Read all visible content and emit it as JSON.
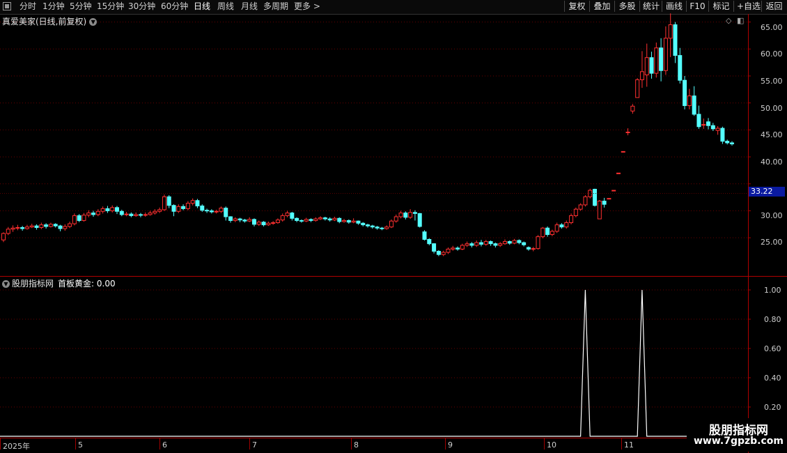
{
  "toolbar": {
    "periods": [
      "分时",
      "1分钟",
      "5分钟",
      "15分钟",
      "30分钟",
      "60分钟",
      "日线",
      "周线",
      "月线",
      "多周期",
      "更多 >"
    ],
    "active_period": "日线",
    "right_buttons": [
      "复权",
      "叠加",
      "多股",
      "统计",
      "画线",
      "F10",
      "标记",
      "+自选",
      "返回"
    ]
  },
  "main_chart": {
    "title": "真爱美家(日线,前复权)",
    "current_price": "33.22",
    "y_ticks": [
      "65.00",
      "60.00",
      "55.00",
      "50.00",
      "45.00",
      "40.00",
      "30.00",
      "25.00"
    ],
    "up_color": "#ff3030",
    "down_color": "#54ffff"
  },
  "indicator": {
    "source": "股朋指标网",
    "name_value": "首板黄金: 0.00",
    "y_ticks": [
      "1.00",
      "0.80",
      "0.60",
      "0.40",
      "0.20"
    ]
  },
  "x_axis": {
    "labels": [
      "2025年",
      "5",
      "6",
      "7",
      "8",
      "9",
      "10",
      "11"
    ]
  },
  "watermark": {
    "title": "股朋指标网",
    "url": "www.7gpzb.com"
  },
  "chart_data": {
    "type": "candlestick",
    "ylim": [
      20.5,
      66.5
    ],
    "candles": [
      [
        24.6,
        25.8,
        24.2,
        26.0
      ],
      [
        25.8,
        26.6,
        25.5,
        27.0
      ],
      [
        26.6,
        26.8,
        26.1,
        27.3
      ],
      [
        26.8,
        26.9,
        26.4,
        27.4
      ],
      [
        26.9,
        26.7,
        26.3,
        27.2
      ],
      [
        26.7,
        27.0,
        26.5,
        27.4
      ],
      [
        27.0,
        27.2,
        26.8,
        27.6
      ],
      [
        27.2,
        26.9,
        26.5,
        27.5
      ],
      [
        26.9,
        27.4,
        26.6,
        27.8
      ],
      [
        27.4,
        27.1,
        26.7,
        27.7
      ],
      [
        27.1,
        27.5,
        26.9,
        27.8
      ],
      [
        27.5,
        27.2,
        26.9,
        27.7
      ],
      [
        27.2,
        26.7,
        26.2,
        27.4
      ],
      [
        26.7,
        27.1,
        26.3,
        27.5
      ],
      [
        27.1,
        27.6,
        26.8,
        28.0
      ],
      [
        27.6,
        29.1,
        27.3,
        29.5
      ],
      [
        29.1,
        28.2,
        27.9,
        29.4
      ],
      [
        28.2,
        29.2,
        28.0,
        29.6
      ],
      [
        29.2,
        29.6,
        28.8,
        30.1
      ],
      [
        29.6,
        29.3,
        28.9,
        30.0
      ],
      [
        29.3,
        29.9,
        29.0,
        30.3
      ],
      [
        29.9,
        30.4,
        29.5,
        30.8
      ],
      [
        30.4,
        30.0,
        29.6,
        30.9
      ],
      [
        30.0,
        30.6,
        29.7,
        31.0
      ],
      [
        30.6,
        29.9,
        29.4,
        30.9
      ],
      [
        29.9,
        29.3,
        29.0,
        30.2
      ],
      [
        29.3,
        29.4,
        29.0,
        29.8
      ],
      [
        29.4,
        29.1,
        28.8,
        29.7
      ],
      [
        29.1,
        29.3,
        28.9,
        29.7
      ],
      [
        29.3,
        29.2,
        28.8,
        29.6
      ],
      [
        29.2,
        29.3,
        28.9,
        29.7
      ],
      [
        29.3,
        29.6,
        29.1,
        30.0
      ],
      [
        29.6,
        29.9,
        29.3,
        30.3
      ],
      [
        29.9,
        30.2,
        29.6,
        30.6
      ],
      [
        30.2,
        32.6,
        30.0,
        33.0
      ],
      [
        32.6,
        31.0,
        30.5,
        32.9
      ],
      [
        31.0,
        29.9,
        29.0,
        31.2
      ],
      [
        29.9,
        30.8,
        29.6,
        31.2
      ],
      [
        30.8,
        30.4,
        30.1,
        31.2
      ],
      [
        30.4,
        31.4,
        30.1,
        31.8
      ],
      [
        31.4,
        31.9,
        31.0,
        32.3
      ],
      [
        31.9,
        30.9,
        30.5,
        32.2
      ],
      [
        30.9,
        30.1,
        29.8,
        31.2
      ],
      [
        30.1,
        30.0,
        29.6,
        30.4
      ],
      [
        30.0,
        29.8,
        29.5,
        30.3
      ],
      [
        29.8,
        29.9,
        29.5,
        30.2
      ],
      [
        29.9,
        30.5,
        29.6,
        30.8
      ],
      [
        30.5,
        28.9,
        28.2,
        30.8
      ],
      [
        28.9,
        28.2,
        27.8,
        29.0
      ],
      [
        28.2,
        28.5,
        27.9,
        28.8
      ],
      [
        28.5,
        28.3,
        27.9,
        28.7
      ],
      [
        28.3,
        28.1,
        27.8,
        28.5
      ],
      [
        28.1,
        28.4,
        27.9,
        28.8
      ],
      [
        28.4,
        27.5,
        27.1,
        28.6
      ],
      [
        27.5,
        27.9,
        27.2,
        28.2
      ],
      [
        27.9,
        27.4,
        27.1,
        28.1
      ],
      [
        27.4,
        27.7,
        27.2,
        28.0
      ],
      [
        27.7,
        27.8,
        27.4,
        28.1
      ],
      [
        27.8,
        28.3,
        27.6,
        28.6
      ],
      [
        28.3,
        29.1,
        28.0,
        29.5
      ],
      [
        29.1,
        29.6,
        28.8,
        30.0
      ],
      [
        29.6,
        28.6,
        28.2,
        29.8
      ],
      [
        28.6,
        28.2,
        27.9,
        28.8
      ],
      [
        28.2,
        28.1,
        27.8,
        28.4
      ],
      [
        28.1,
        28.4,
        27.9,
        28.7
      ],
      [
        28.4,
        28.2,
        27.9,
        28.6
      ],
      [
        28.2,
        28.5,
        28.0,
        28.8
      ],
      [
        28.5,
        28.7,
        28.3,
        29.0
      ],
      [
        28.7,
        28.5,
        28.2,
        28.9
      ],
      [
        28.5,
        28.3,
        28.0,
        28.8
      ],
      [
        28.3,
        28.6,
        28.1,
        28.9
      ],
      [
        28.6,
        28.0,
        27.7,
        28.8
      ],
      [
        28.0,
        28.2,
        27.8,
        28.5
      ],
      [
        28.2,
        27.9,
        27.6,
        28.4
      ],
      [
        27.9,
        28.1,
        27.7,
        28.6
      ],
      [
        28.1,
        27.7,
        27.4,
        28.2
      ],
      [
        27.7,
        27.4,
        27.1,
        27.9
      ],
      [
        27.4,
        27.2,
        26.9,
        27.6
      ],
      [
        27.2,
        27.0,
        26.7,
        27.4
      ],
      [
        27.0,
        26.8,
        26.5,
        27.2
      ],
      [
        26.8,
        26.7,
        26.4,
        27.0
      ],
      [
        26.7,
        27.0,
        26.5,
        27.3
      ],
      [
        27.0,
        28.1,
        26.8,
        28.4
      ],
      [
        28.1,
        28.9,
        27.8,
        29.3
      ],
      [
        28.9,
        29.6,
        28.6,
        30.0
      ],
      [
        29.6,
        28.8,
        28.4,
        29.9
      ],
      [
        28.8,
        29.7,
        28.5,
        30.3
      ],
      [
        29.7,
        29.5,
        28.2,
        30.1
      ],
      [
        29.5,
        27.1,
        26.9,
        29.6
      ],
      [
        26.1,
        24.7,
        24.5,
        26.4
      ],
      [
        24.7,
        23.9,
        23.6,
        24.9
      ],
      [
        23.9,
        22.5,
        22.1,
        24.0
      ],
      [
        22.5,
        21.9,
        21.6,
        22.7
      ],
      [
        21.9,
        22.3,
        21.6,
        22.6
      ],
      [
        22.3,
        22.9,
        22.0,
        23.2
      ],
      [
        22.9,
        23.1,
        22.6,
        23.5
      ],
      [
        23.1,
        22.9,
        22.6,
        23.4
      ],
      [
        22.9,
        23.6,
        22.7,
        23.9
      ],
      [
        23.6,
        23.9,
        23.3,
        24.3
      ],
      [
        23.9,
        23.6,
        23.2,
        24.2
      ],
      [
        23.6,
        24.1,
        23.3,
        24.5
      ],
      [
        24.1,
        23.8,
        23.4,
        24.6
      ],
      [
        23.8,
        24.3,
        23.5,
        24.6
      ],
      [
        24.3,
        23.9,
        23.5,
        24.5
      ],
      [
        23.9,
        23.6,
        23.2,
        24.1
      ],
      [
        23.6,
        23.9,
        23.3,
        24.2
      ],
      [
        23.9,
        24.3,
        23.7,
        24.7
      ],
      [
        24.3,
        24.0,
        23.7,
        24.5
      ],
      [
        24.0,
        24.5,
        23.8,
        24.8
      ],
      [
        24.5,
        24.1,
        23.8,
        24.7
      ],
      [
        24.1,
        23.7,
        23.4,
        24.3
      ],
      [
        23.2,
        22.9,
        22.6,
        23.4
      ],
      [
        22.9,
        23.0,
        22.5,
        23.3
      ],
      [
        23.0,
        25.2,
        22.8,
        25.5
      ],
      [
        25.2,
        26.8,
        24.9,
        27.0
      ],
      [
        26.8,
        25.6,
        25.2,
        27.1
      ],
      [
        25.6,
        26.2,
        25.3,
        26.5
      ],
      [
        26.2,
        27.4,
        25.9,
        27.8
      ],
      [
        27.4,
        27.0,
        26.7,
        27.7
      ],
      [
        27.0,
        27.8,
        26.7,
        28.2
      ],
      [
        27.8,
        29.1,
        27.5,
        29.5
      ],
      [
        29.1,
        30.3,
        28.8,
        30.6
      ],
      [
        30.3,
        31.1,
        30.0,
        31.4
      ],
      [
        31.1,
        32.6,
        30.8,
        32.9
      ],
      [
        32.6,
        33.8,
        32.3,
        34.1
      ],
      [
        34.0,
        31.0,
        30.8,
        34.1
      ],
      [
        28.5,
        31.8,
        28.5,
        32.0
      ],
      [
        31.8,
        31.2,
        30.6,
        32.4
      ],
      [
        32.3,
        32.3,
        32.3,
        32.3
      ],
      [
        33.8,
        33.8,
        33.8,
        33.8
      ],
      [
        37.0,
        37.0,
        37.0,
        37.0
      ],
      [
        41.0,
        41.0,
        41.0,
        41.0
      ],
      [
        44.6,
        44.6,
        44.0,
        45.3
      ],
      [
        48.5,
        49.4,
        48.0,
        49.8
      ],
      [
        51.0,
        54.3,
        51.0,
        54.6
      ],
      [
        54.3,
        55.8,
        52.8,
        59.6
      ],
      [
        55.2,
        58.4,
        53.0,
        61.0
      ],
      [
        58.4,
        55.5,
        54.5,
        59.5
      ],
      [
        55.5,
        60.2,
        54.7,
        61.2
      ],
      [
        60.2,
        56.0,
        54.0,
        62.0
      ],
      [
        56.0,
        62.0,
        55.2,
        64.2
      ],
      [
        62.0,
        64.5,
        58.5,
        66.6
      ],
      [
        64.5,
        58.8,
        57.4,
        65.0
      ],
      [
        58.8,
        54.2,
        53.6,
        60.2
      ],
      [
        54.2,
        49.5,
        48.8,
        55.0
      ],
      [
        49.5,
        51.3,
        48.8,
        52.6
      ],
      [
        51.3,
        47.9,
        47.6,
        53.1
      ],
      [
        47.9,
        45.6,
        45.2,
        49.5
      ],
      [
        46.0,
        46.0,
        45.2,
        47.1
      ],
      [
        46.5,
        45.8,
        45.1,
        47.2
      ],
      [
        45.8,
        45.2,
        44.8,
        46.3
      ],
      [
        44.9,
        45.3,
        44.1,
        45.7
      ],
      [
        45.3,
        42.9,
        42.4,
        45.6
      ],
      [
        42.9,
        42.6,
        42.3,
        43.2
      ],
      [
        42.6,
        42.4,
        42.1,
        42.9
      ]
    ],
    "indicator_signals": [
      {
        "index": 123,
        "value": 1.0
      },
      {
        "index": 135,
        "value": 1.0
      }
    ]
  }
}
